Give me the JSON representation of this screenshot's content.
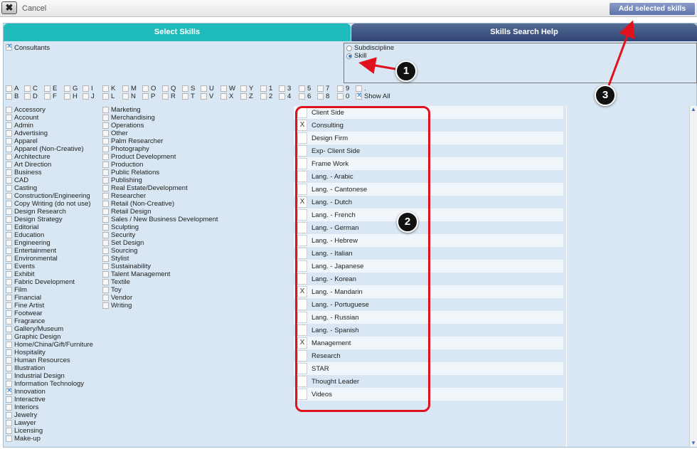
{
  "topbar": {
    "cancel_label": "Cancel",
    "add_button": "Add selected skills"
  },
  "tabs": {
    "select_skills": "Select Skills",
    "skills_search_help": "Skills Search Help"
  },
  "consultants": {
    "label": "Consultants",
    "checked": true
  },
  "search_type": {
    "options": [
      "Subdiscipline",
      "Skill"
    ],
    "selected": "Skill"
  },
  "letters_row1": [
    "A",
    "C",
    "E",
    "G",
    "I",
    "K",
    "M",
    "O",
    "Q",
    "S",
    "U",
    "W",
    "Y",
    "1",
    "3",
    "5",
    "7",
    "9",
    "."
  ],
  "letters_row2": [
    "B",
    "D",
    "F",
    "H",
    "J",
    "L",
    "N",
    "P",
    "R",
    "T",
    "V",
    "X",
    "Z",
    "2",
    "4",
    "6",
    "8",
    "0"
  ],
  "show_all": {
    "label": "Show All",
    "checked": true
  },
  "disciplines_col1": [
    "Accessory",
    "Account",
    "Admin",
    "Advertising",
    "Apparel",
    "Apparel (Non-Creative)",
    "Architecture",
    "Art Direction",
    "Business",
    "CAD",
    "Casting",
    "Construction/Engineering",
    "Copy Writing (do not use)",
    "Design Research",
    "Design Strategy",
    "Editorial",
    "Education",
    "Engineering",
    "Entertainment",
    "Environmental",
    "Events",
    "Exhibit",
    "Fabric Development",
    "Film",
    "Financial",
    "Fine Artist",
    "Footwear",
    "Fragrance",
    "Gallery/Museum",
    "Graphic Design",
    "Home/China/Gift/Furniture",
    "Hospitality",
    "Human Resources",
    "Illustration",
    "Industrial Design",
    "Information Technology",
    "Innovation",
    "Interactive",
    "Interiors",
    "Jewelry",
    "Lawyer",
    "Licensing",
    "Make-up"
  ],
  "disciplines_col1_checked": [
    "Innovation"
  ],
  "disciplines_col2": [
    "Marketing",
    "Merchandising",
    "Operations",
    "Other",
    "Palm Researcher",
    "Photography",
    "Product Development",
    "Production",
    "Public Relations",
    "Publishing",
    "Real Estate/Development",
    "Researcher",
    "Retail  (Non-Creative)",
    "Retail Design",
    "Sales / New Business Development",
    "Sculpting",
    "Security",
    "Set Design",
    "Sourcing",
    "Stylist",
    "Sustainability",
    "Talent Management",
    "Textile",
    "Toy",
    "Vendor",
    "Writing"
  ],
  "skills": [
    {
      "label": "Client Side",
      "checked": false
    },
    {
      "label": "Consulting",
      "checked": true
    },
    {
      "label": "Design Firm",
      "checked": false
    },
    {
      "label": "Exp- Client Side",
      "checked": false
    },
    {
      "label": "Frame Work",
      "checked": false
    },
    {
      "label": "Lang. - Arabic",
      "checked": false
    },
    {
      "label": "Lang. - Cantonese",
      "checked": false
    },
    {
      "label": "Lang. - Dutch",
      "checked": true
    },
    {
      "label": "Lang. - French",
      "checked": false
    },
    {
      "label": "Lang. - German",
      "checked": false
    },
    {
      "label": "Lang. - Hebrew",
      "checked": false
    },
    {
      "label": "Lang. - Italian",
      "checked": false
    },
    {
      "label": "Lang. - Japanese",
      "checked": false
    },
    {
      "label": "Lang. - Korean",
      "checked": false
    },
    {
      "label": "Lang. - Mandarin",
      "checked": true
    },
    {
      "label": "Lang. - Portuguese",
      "checked": false
    },
    {
      "label": "Lang. - Russian",
      "checked": false
    },
    {
      "label": "Lang. - Spanish",
      "checked": false
    },
    {
      "label": "Management",
      "checked": true
    },
    {
      "label": "Research",
      "checked": false
    },
    {
      "label": "STAR",
      "checked": false
    },
    {
      "label": "Thought Leader",
      "checked": false
    },
    {
      "label": "Videos",
      "checked": false
    }
  ],
  "callouts": [
    "1",
    "2",
    "3"
  ],
  "icons": {
    "close": "close-icon",
    "scroll_up": "scroll-up-arrow-icon",
    "scroll_down": "scroll-down-arrow-icon"
  },
  "colors": {
    "tab_active": "#20bcbc",
    "tab_inactive": "#2f4473",
    "annotation_red": "#e0121e",
    "panel_bg": "#d8e7f3"
  }
}
